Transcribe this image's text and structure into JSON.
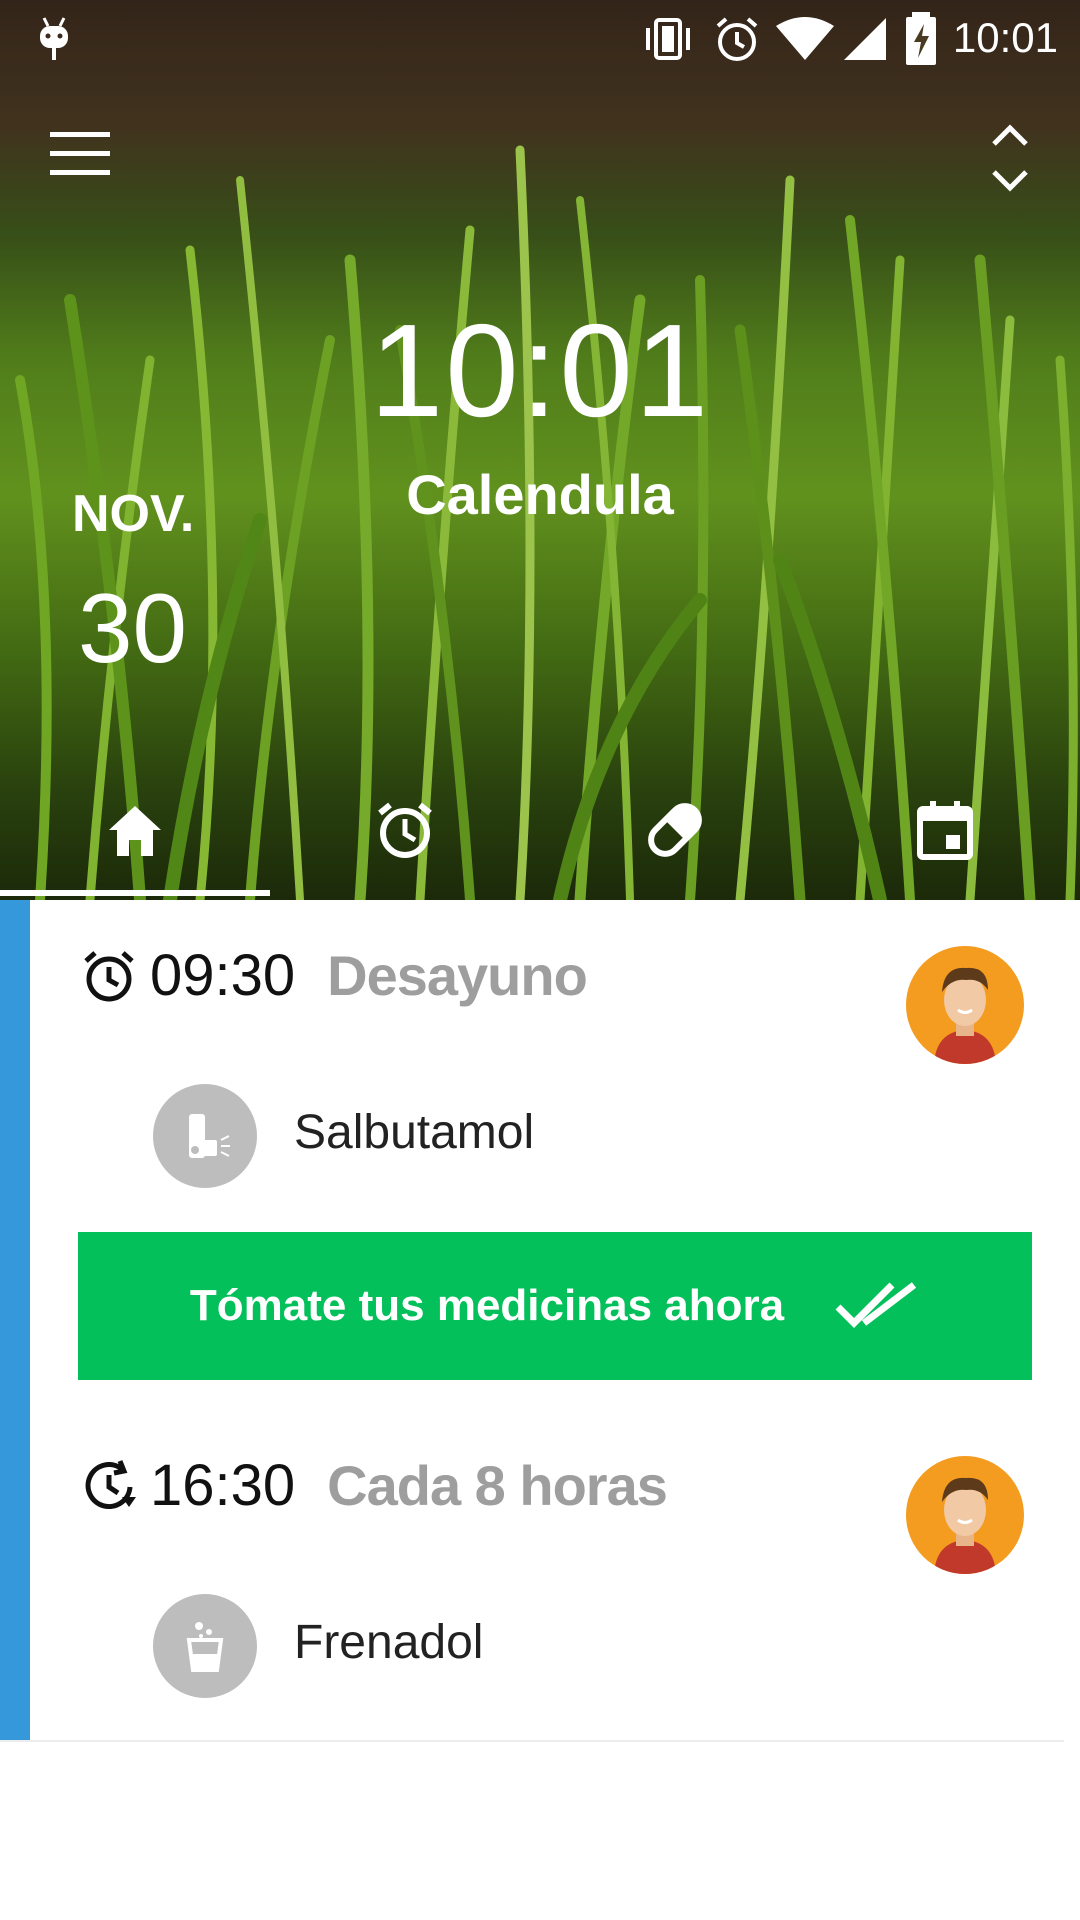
{
  "status_bar": {
    "time": "10:01",
    "icons": [
      "android-icon",
      "vibrate-icon",
      "alarm-icon",
      "wifi-icon",
      "signal-icon",
      "battery-charging-icon"
    ]
  },
  "header": {
    "clock": "10:01",
    "app_name": "Calendula",
    "month": "NOV.",
    "day": "30",
    "menu_icon": "hamburger-menu-icon",
    "expand_icon": "expand-collapse-icon"
  },
  "tabs": [
    {
      "name": "home",
      "icon": "home-icon",
      "selected": true
    },
    {
      "name": "alarms",
      "icon": "alarm-clock-icon",
      "selected": false
    },
    {
      "name": "medicines",
      "icon": "pill-icon",
      "selected": false
    },
    {
      "name": "calendar",
      "icon": "calendar-icon",
      "selected": false
    }
  ],
  "schedule": [
    {
      "time": "09:30",
      "label": "Desayuno",
      "time_icon": "alarm-clock-icon",
      "medicine": "Salbutamol",
      "medicine_icon": "inhaler-icon",
      "action_label": "Tómate tus medicinas ahora",
      "action_icon": "double-check-icon"
    },
    {
      "time": "16:30",
      "label": "Cada 8 horas",
      "time_icon": "repeat-clock-icon",
      "medicine": "Frenadol",
      "medicine_icon": "effervescent-glass-icon"
    }
  ],
  "colors": {
    "accent_bar": "#3598db",
    "action_button": "#04c05a",
    "avatar_bg": "#f39c20",
    "label_gray": "#9e9e9e"
  }
}
